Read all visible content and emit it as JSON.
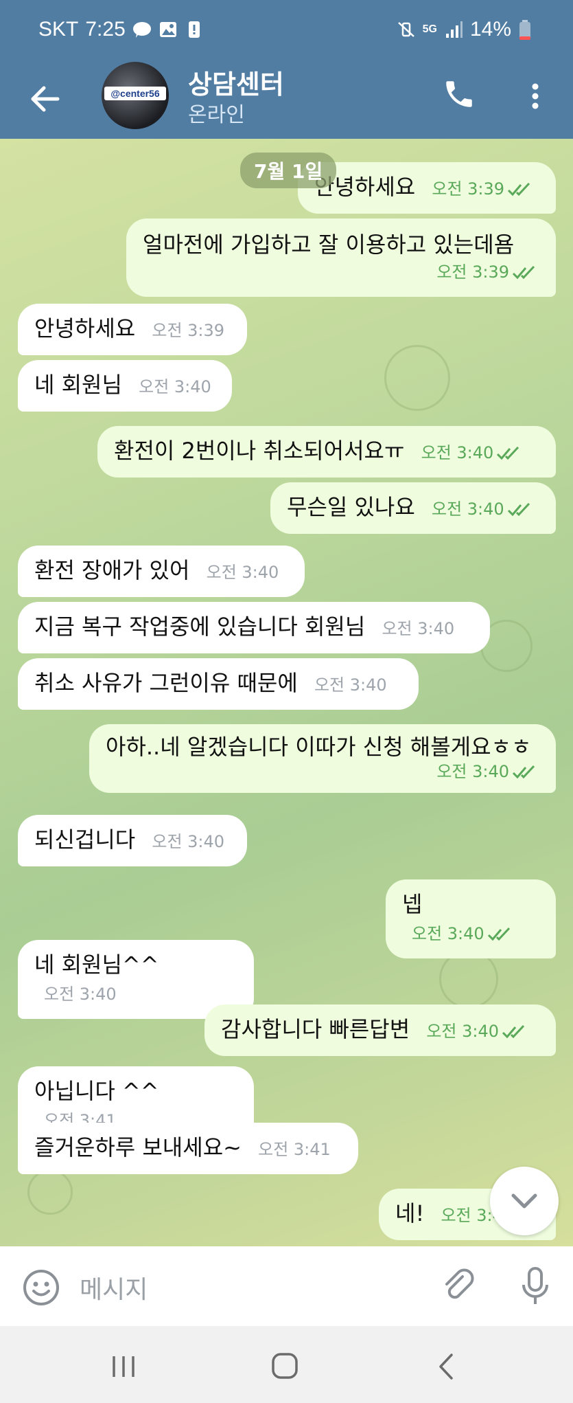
{
  "status_bar": {
    "carrier": "SKT",
    "time": "7:25",
    "network": "5G",
    "battery": "14%"
  },
  "header": {
    "title": "상담센터",
    "subtitle": "온라인",
    "avatar_tag": "@center56"
  },
  "chat": {
    "date_badge": "7월 1일",
    "messages": [
      {
        "dir": "out",
        "text": "안녕하세요",
        "time": "오전 3:39"
      },
      {
        "dir": "out",
        "text": "얼마전에 가입하고 잘 이용하고 있는데욤",
        "time": "오전 3:39"
      },
      {
        "dir": "in",
        "text": "안녕하세요",
        "time": "오전 3:39"
      },
      {
        "dir": "in",
        "text": "네 회원님",
        "time": "오전 3:40"
      },
      {
        "dir": "out",
        "text": "환전이 2번이나 취소되어서요ㅠ",
        "time": "오전 3:40"
      },
      {
        "dir": "out",
        "text": "무슨일 있나요",
        "time": "오전 3:40"
      },
      {
        "dir": "in",
        "text": "환전 장애가 있어",
        "time": "오전 3:40"
      },
      {
        "dir": "in",
        "text": "지금 복구 작업중에 있습니다 회원님",
        "time": "오전 3:40"
      },
      {
        "dir": "in",
        "text": "취소 사유가 그런이유 때문에",
        "time": "오전 3:40"
      },
      {
        "dir": "out",
        "text": "아하..네 알겠습니다 이따가 신청 해볼게요ㅎㅎ",
        "time": "오전 3:40"
      },
      {
        "dir": "in",
        "text": "되신겁니다",
        "time": "오전 3:40"
      },
      {
        "dir": "out",
        "text": "넵",
        "time": "오전 3:40"
      },
      {
        "dir": "in",
        "text": "네 회원님^^",
        "time": "오전 3:40"
      },
      {
        "dir": "out",
        "text": "감사합니다 빠른답변",
        "time": "오전 3:40"
      },
      {
        "dir": "in",
        "text": "아닙니다 ^^",
        "time": "오전 3:41"
      },
      {
        "dir": "in",
        "text": "즐거운하루 보내세요~",
        "time": "오전 3:41"
      },
      {
        "dir": "out",
        "text": "네!",
        "time": "오전 3:4"
      }
    ]
  },
  "composer": {
    "placeholder": "메시지"
  },
  "colors": {
    "header": "#527da3",
    "outgoing": "#effdde",
    "incoming": "#ffffff",
    "check": "#5aa85a"
  }
}
